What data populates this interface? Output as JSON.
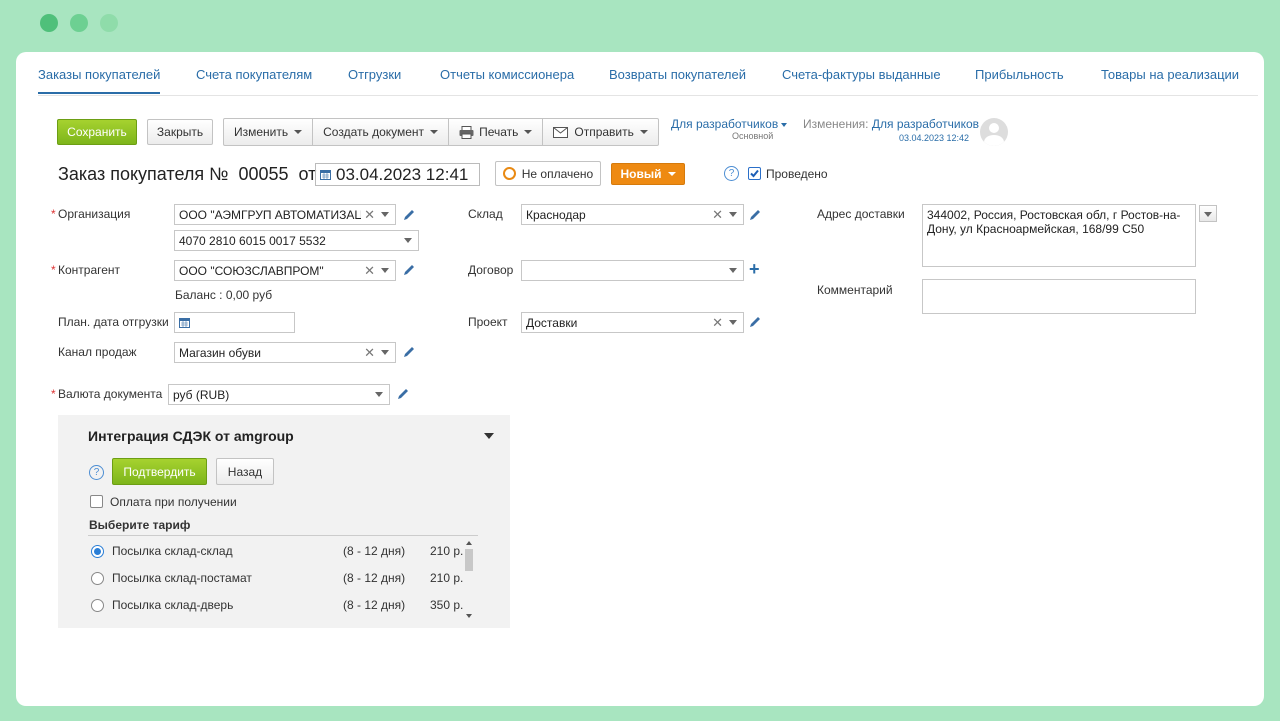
{
  "tabs": [
    "Заказы покупателей",
    "Счета покупателям",
    "Отгрузки",
    "Отчеты комиссионера",
    "Возвраты покупателей",
    "Счета-фактуры выданные",
    "Прибыльность",
    "Товары на реализации"
  ],
  "toolbar": {
    "save": "Сохранить",
    "close": "Закрыть",
    "edit": "Изменить",
    "create": "Создать документ",
    "print": "Печать",
    "send": "Отправить"
  },
  "dev": {
    "label": "Для разработчиков",
    "sub": "Основной"
  },
  "changes": {
    "label": "Изменения:",
    "user": "Для разработчиков",
    "date": "03.04.2023 12:42"
  },
  "doc": {
    "title": "Заказ покупателя №",
    "number": "00055",
    "from": "от",
    "date": "03.04.2023 12:41",
    "payment": "Не оплачено",
    "status": "Новый",
    "posted": "Проведено"
  },
  "form": {
    "org_label": "Организация",
    "org_value": "ООО \"АЭМГРУП АВТОМАТИЗАЦИ",
    "account_value": "4070 2810 6015 0017 5532",
    "contractor_label": "Контрагент",
    "contractor_value": "ООО \"СОЮЗСЛАВПРОМ\"",
    "balance": "Баланс : 0,00 руб",
    "plan_label": "План. дата отгрузки",
    "channel_label": "Канал продаж",
    "channel_value": "Магазин обуви",
    "currency_label": "Валюта документа",
    "currency_value": "руб (RUB)",
    "warehouse_label": "Склад",
    "warehouse_value": "Краснодар",
    "contract_label": "Договор",
    "project_label": "Проект",
    "project_value": "Доставки",
    "address_label": "Адрес доставки",
    "address_value": "344002, Россия, Ростовская обл, г Ростов-на-Дону, ул Красноармейская, 168/99 С50",
    "comment_label": "Комментарий"
  },
  "cdek": {
    "title": "Интеграция СДЭК от amgroup",
    "confirm": "Подтвердить",
    "back": "Назад",
    "cod": "Оплата при получении",
    "tariff_label": "Выберите тариф",
    "tariffs": [
      {
        "name": "Посылка склад-склад",
        "days": "(8 - 12 дня)",
        "price": "210 р."
      },
      {
        "name": "Посылка склад-постамат",
        "days": "(8 - 12 дня)",
        "price": "210 р."
      },
      {
        "name": "Посылка склад-дверь",
        "days": "(8 - 12 дня)",
        "price": "350 р."
      }
    ]
  }
}
